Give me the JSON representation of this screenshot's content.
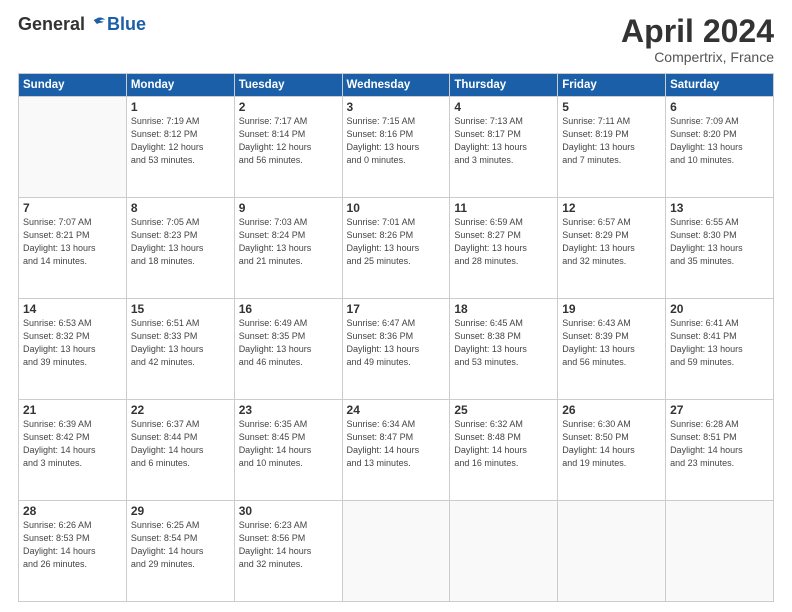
{
  "header": {
    "logo_general": "General",
    "logo_blue": "Blue",
    "month_title": "April 2024",
    "subtitle": "Compertrix, France"
  },
  "weekdays": [
    "Sunday",
    "Monday",
    "Tuesday",
    "Wednesday",
    "Thursday",
    "Friday",
    "Saturday"
  ],
  "weeks": [
    [
      {
        "day": "",
        "info": ""
      },
      {
        "day": "1",
        "info": "Sunrise: 7:19 AM\nSunset: 8:12 PM\nDaylight: 12 hours\nand 53 minutes."
      },
      {
        "day": "2",
        "info": "Sunrise: 7:17 AM\nSunset: 8:14 PM\nDaylight: 12 hours\nand 56 minutes."
      },
      {
        "day": "3",
        "info": "Sunrise: 7:15 AM\nSunset: 8:16 PM\nDaylight: 13 hours\nand 0 minutes."
      },
      {
        "day": "4",
        "info": "Sunrise: 7:13 AM\nSunset: 8:17 PM\nDaylight: 13 hours\nand 3 minutes."
      },
      {
        "day": "5",
        "info": "Sunrise: 7:11 AM\nSunset: 8:19 PM\nDaylight: 13 hours\nand 7 minutes."
      },
      {
        "day": "6",
        "info": "Sunrise: 7:09 AM\nSunset: 8:20 PM\nDaylight: 13 hours\nand 10 minutes."
      }
    ],
    [
      {
        "day": "7",
        "info": "Sunrise: 7:07 AM\nSunset: 8:21 PM\nDaylight: 13 hours\nand 14 minutes."
      },
      {
        "day": "8",
        "info": "Sunrise: 7:05 AM\nSunset: 8:23 PM\nDaylight: 13 hours\nand 18 minutes."
      },
      {
        "day": "9",
        "info": "Sunrise: 7:03 AM\nSunset: 8:24 PM\nDaylight: 13 hours\nand 21 minutes."
      },
      {
        "day": "10",
        "info": "Sunrise: 7:01 AM\nSunset: 8:26 PM\nDaylight: 13 hours\nand 25 minutes."
      },
      {
        "day": "11",
        "info": "Sunrise: 6:59 AM\nSunset: 8:27 PM\nDaylight: 13 hours\nand 28 minutes."
      },
      {
        "day": "12",
        "info": "Sunrise: 6:57 AM\nSunset: 8:29 PM\nDaylight: 13 hours\nand 32 minutes."
      },
      {
        "day": "13",
        "info": "Sunrise: 6:55 AM\nSunset: 8:30 PM\nDaylight: 13 hours\nand 35 minutes."
      }
    ],
    [
      {
        "day": "14",
        "info": "Sunrise: 6:53 AM\nSunset: 8:32 PM\nDaylight: 13 hours\nand 39 minutes."
      },
      {
        "day": "15",
        "info": "Sunrise: 6:51 AM\nSunset: 8:33 PM\nDaylight: 13 hours\nand 42 minutes."
      },
      {
        "day": "16",
        "info": "Sunrise: 6:49 AM\nSunset: 8:35 PM\nDaylight: 13 hours\nand 46 minutes."
      },
      {
        "day": "17",
        "info": "Sunrise: 6:47 AM\nSunset: 8:36 PM\nDaylight: 13 hours\nand 49 minutes."
      },
      {
        "day": "18",
        "info": "Sunrise: 6:45 AM\nSunset: 8:38 PM\nDaylight: 13 hours\nand 53 minutes."
      },
      {
        "day": "19",
        "info": "Sunrise: 6:43 AM\nSunset: 8:39 PM\nDaylight: 13 hours\nand 56 minutes."
      },
      {
        "day": "20",
        "info": "Sunrise: 6:41 AM\nSunset: 8:41 PM\nDaylight: 13 hours\nand 59 minutes."
      }
    ],
    [
      {
        "day": "21",
        "info": "Sunrise: 6:39 AM\nSunset: 8:42 PM\nDaylight: 14 hours\nand 3 minutes."
      },
      {
        "day": "22",
        "info": "Sunrise: 6:37 AM\nSunset: 8:44 PM\nDaylight: 14 hours\nand 6 minutes."
      },
      {
        "day": "23",
        "info": "Sunrise: 6:35 AM\nSunset: 8:45 PM\nDaylight: 14 hours\nand 10 minutes."
      },
      {
        "day": "24",
        "info": "Sunrise: 6:34 AM\nSunset: 8:47 PM\nDaylight: 14 hours\nand 13 minutes."
      },
      {
        "day": "25",
        "info": "Sunrise: 6:32 AM\nSunset: 8:48 PM\nDaylight: 14 hours\nand 16 minutes."
      },
      {
        "day": "26",
        "info": "Sunrise: 6:30 AM\nSunset: 8:50 PM\nDaylight: 14 hours\nand 19 minutes."
      },
      {
        "day": "27",
        "info": "Sunrise: 6:28 AM\nSunset: 8:51 PM\nDaylight: 14 hours\nand 23 minutes."
      }
    ],
    [
      {
        "day": "28",
        "info": "Sunrise: 6:26 AM\nSunset: 8:53 PM\nDaylight: 14 hours\nand 26 minutes."
      },
      {
        "day": "29",
        "info": "Sunrise: 6:25 AM\nSunset: 8:54 PM\nDaylight: 14 hours\nand 29 minutes."
      },
      {
        "day": "30",
        "info": "Sunrise: 6:23 AM\nSunset: 8:56 PM\nDaylight: 14 hours\nand 32 minutes."
      },
      {
        "day": "",
        "info": ""
      },
      {
        "day": "",
        "info": ""
      },
      {
        "day": "",
        "info": ""
      },
      {
        "day": "",
        "info": ""
      }
    ]
  ]
}
